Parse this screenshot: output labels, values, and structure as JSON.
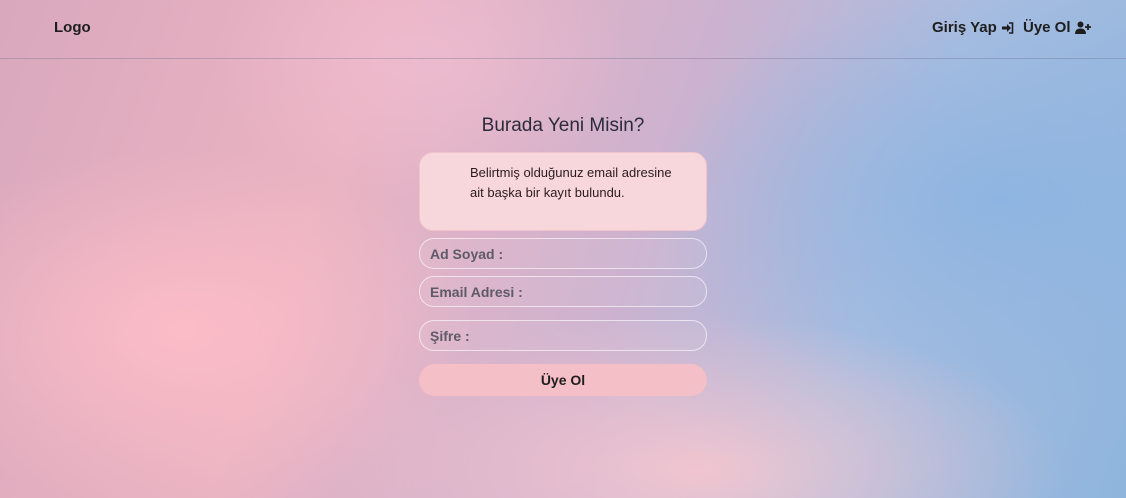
{
  "nav": {
    "logo": "Logo",
    "login_label": "Giriş Yap",
    "login_icon": "sign-in-icon",
    "register_label": "Üye Ol",
    "register_icon": "user-plus-icon"
  },
  "form": {
    "title": "Burada Yeni Misin?",
    "alert": "Belirtmiş olduğunuz email adresine ait başka bir kayıt bulundu.",
    "name_placeholder": "Ad Soyad :",
    "email_placeholder": "Email Adresi :",
    "password_placeholder": "Şifre :",
    "submit_label": "Üye Ol"
  },
  "colors": {
    "alert_bg": "#f8d7dc",
    "button_bg": "#f4bfc6",
    "text_dark": "#1e1e1e"
  }
}
